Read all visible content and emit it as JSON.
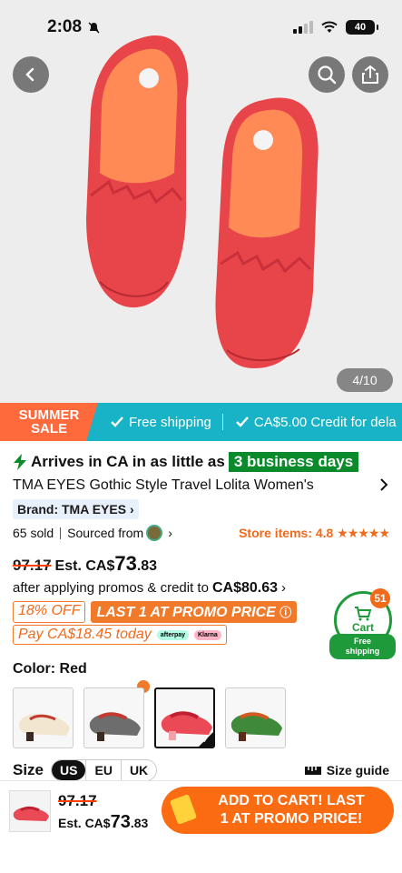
{
  "status": {
    "time": "2:08",
    "battery": "40"
  },
  "gallery": {
    "counter": "4/10"
  },
  "promo": {
    "badge_line1": "SUMMER",
    "badge_line2": "SALE",
    "item1": "Free shipping",
    "item2": "CA$5.00 Credit for dela"
  },
  "product": {
    "arrives_prefix": "Arrives in CA in as little as",
    "arrives_badge": "3 business days",
    "title": "TMA EYES Gothic Style Travel Lolita Women's",
    "brand": "Brand: TMA EYES",
    "sold": "65 sold",
    "sourced": "Sourced from",
    "store": "Store items: 4.8",
    "stars": "★★★★★",
    "old_price": "97.17",
    "est_prefix": "Est. CA$",
    "est_whole": "73",
    "est_cents": ".83",
    "after_text": "after applying promos & credit to",
    "after_amount": "CA$80.63",
    "discount": "18% OFF",
    "last_one": "LAST 1 AT PROMO PRICE",
    "pay_today": "Pay CA$18.45 today",
    "afterpay": "afterpay",
    "klarna": "Klarna"
  },
  "cart": {
    "count": "51",
    "label": "Cart",
    "free_shipping_1": "Free",
    "free_shipping_2": "shipping"
  },
  "color": {
    "label": "Color: Red",
    "selected_index": 2
  },
  "size": {
    "label": "Size",
    "options": [
      "US",
      "EU",
      "UK"
    ],
    "active": "US",
    "guide": "Size guide"
  },
  "bottom": {
    "old_price": "97.17",
    "est_prefix": "Est. CA$",
    "est_whole": "73",
    "est_cents": ".83",
    "add_line1": "ADD TO CART! LAST",
    "add_line2": "1 AT PROMO PRICE!"
  },
  "colors": {
    "accent": "#fa6b12",
    "green": "#0a8a2a",
    "teal": "#18b3c6"
  }
}
